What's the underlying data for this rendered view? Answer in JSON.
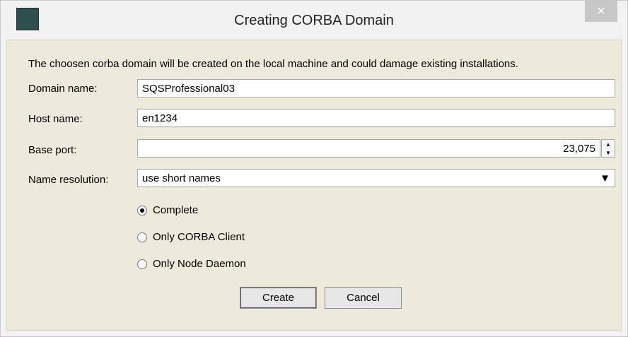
{
  "window": {
    "title": "Creating CORBA Domain",
    "close_label": "×"
  },
  "dialog": {
    "description": "The choosen corba domain will be created on the local machine and could damage existing installations.",
    "domain_name": {
      "label": "Domain name:",
      "value": "SQSProfessional03"
    },
    "host_name": {
      "label": "Host name:",
      "value": "en1234"
    },
    "base_port": {
      "label": "Base port:",
      "value": "23,075"
    },
    "name_resolution": {
      "label": "Name resolution:",
      "value": "use short names"
    },
    "install_options": [
      {
        "label": "Complete",
        "selected": true
      },
      {
        "label": "Only CORBA Client",
        "selected": false
      },
      {
        "label": "Only Node Daemon",
        "selected": false
      }
    ],
    "buttons": {
      "create": "Create",
      "cancel": "Cancel"
    }
  },
  "icons": {
    "app_icon": "wrench-icon",
    "close_icon": "close-icon",
    "spinner_up": "chevron-up-icon",
    "spinner_down": "chevron-down-icon",
    "dropdown": "dropdown-arrow-icon"
  }
}
